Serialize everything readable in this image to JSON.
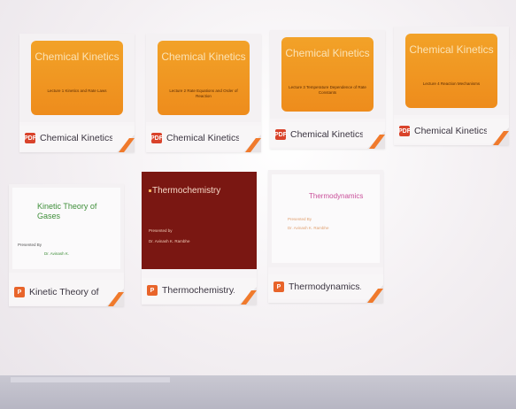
{
  "files": [
    {
      "name": "Chemical Kinetics ...",
      "icon": "pdf-icon",
      "slide_type": "orange",
      "slide_title": "Chemical Kinetics",
      "slide_subtitle": "Lecture 1 Kinetics and Rate Laws",
      "colors": {
        "accent": "#ee8c1c"
      }
    },
    {
      "name": "Chemical Kinetics ...",
      "icon": "pdf-icon",
      "slide_type": "orange",
      "slide_title": "Chemical Kinetics",
      "slide_subtitle": "Lecture 2 Rate Equations and Order of Reaction",
      "colors": {
        "accent": "#ee8c1c"
      }
    },
    {
      "name": "Chemical Kinetics -...",
      "icon": "pdf-icon",
      "slide_type": "orange",
      "slide_title": "Chemical Kinetics",
      "slide_subtitle": "Lecture 3 Temperature Dependence of Rate Constants",
      "colors": {
        "accent": "#ee8c1c"
      }
    },
    {
      "name": "Chemical Kinetics ...",
      "icon": "pdf-icon",
      "slide_type": "orange",
      "slide_title": "Chemical Kinetics",
      "slide_subtitle": "Lecture 4 Reaction Mechanisms",
      "colors": {
        "accent": "#ee8c1c"
      }
    },
    {
      "name": "Kinetic Theory of G...",
      "icon": "ppt-icon",
      "slide_type": "white",
      "slide_title": "Kinetic Theory of Gases",
      "slide_presenter_label": "Presented By",
      "slide_presenter": "Dr. Avinash K."
    },
    {
      "name": "Thermochemistry....",
      "icon": "ppt-icon",
      "slide_type": "dark",
      "slide_title": "Thermochemistry",
      "slide_presenter_label": "Presented by",
      "slide_presenter": "Dr. Avinash K. Rambhe"
    },
    {
      "name": "Thermodynamics.p...",
      "icon": "ppt-icon",
      "slide_type": "white",
      "slide_title": "Thermodynamics",
      "slide_presenter_label": "Presented By",
      "slide_presenter": "Dr. Avinash K. Rambhe"
    }
  ],
  "icon_labels": {
    "pdf": "PDF",
    "ppt": "P"
  }
}
